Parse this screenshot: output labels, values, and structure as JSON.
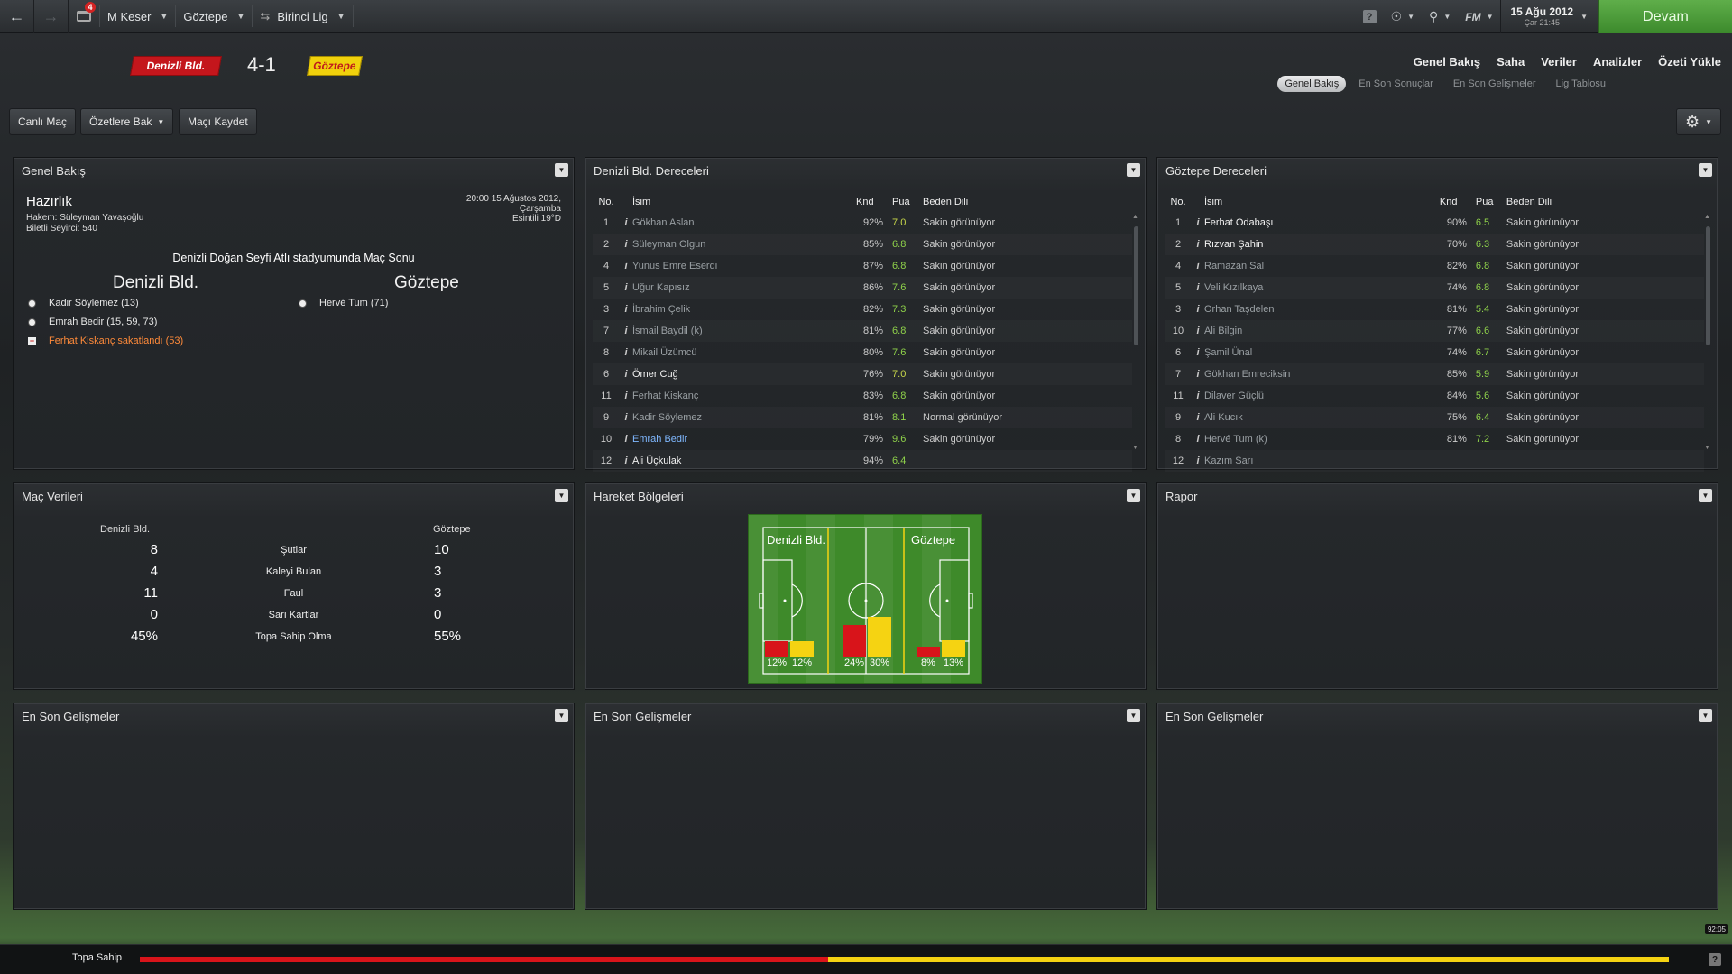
{
  "topbar": {
    "manager": "M Keser",
    "team": "Göztepe",
    "league": "Birinci Lig",
    "inbox_count": "4",
    "fm_label": "FM",
    "date": "15 Ağu 2012",
    "time": "Çar 21:45",
    "continue": "Devam"
  },
  "header": {
    "home": "Denizli Bld.",
    "away": "Göztepe",
    "score": "4-1",
    "main_tabs": [
      "Genel Bakış",
      "Saha",
      "Veriler",
      "Analizler",
      "Özeti Yükle"
    ],
    "sub_tabs": [
      "Genel Bakış",
      "En Son Sonuçlar",
      "En Son Gelişmeler",
      "Lig Tablosu"
    ]
  },
  "toolbar": {
    "live": "Canlı Maç",
    "highlights": "Özetlere Bak",
    "save": "Maçı Kaydet"
  },
  "overview": {
    "title": "Genel Bakış",
    "subtitle": "Hazırlık",
    "referee": "Hakem: Süleyman Yavaşoğlu",
    "attendance": "Biletli Seyirci: 540",
    "datetime": "20:00 15 Ağustos 2012,",
    "weekday": "Çarşamba",
    "weather": "Esintili 19°D",
    "venue": "Denizli Doğan Seyfi Atlı stadyumunda Maç Sonu",
    "home": "Denizli Bld.",
    "away": "Göztepe",
    "home_events": [
      "Kadir Söylemez (13)",
      "Emrah Bedir (15, 59, 73)",
      "Ferhat Kiskanç sakatlandı (53)"
    ],
    "away_events": [
      "Hervé Tum (71)"
    ]
  },
  "home_ratings": {
    "title": "Denizli Bld. Dereceleri",
    "cols": [
      "No.",
      "İsim",
      "Knd",
      "Pua",
      "Beden Dili"
    ],
    "rows": [
      {
        "no": "1",
        "name": "Gökhan Aslan",
        "knd": "92%",
        "pua": "7.0",
        "bd": "Sakin görünüyor",
        "puac": "#c8d84a",
        "st": "dim"
      },
      {
        "no": "2",
        "name": "Süleyman Olgun",
        "knd": "85%",
        "pua": "6.8",
        "bd": "Sakin görünüyor",
        "puac": "#8fd24a",
        "st": "dim"
      },
      {
        "no": "4",
        "name": "Yunus Emre Eserdi",
        "knd": "87%",
        "pua": "6.8",
        "bd": "Sakin görünüyor",
        "puac": "#8fd24a",
        "st": "dim"
      },
      {
        "no": "5",
        "name": "Uğur Kapısız",
        "knd": "86%",
        "pua": "7.6",
        "bd": "Sakin görünüyor",
        "puac": "#8fd24a",
        "st": "dim"
      },
      {
        "no": "3",
        "name": "İbrahim Çelik",
        "knd": "82%",
        "pua": "7.3",
        "bd": "Sakin görünüyor",
        "puac": "#8fd24a",
        "st": "dim"
      },
      {
        "no": "7",
        "name": "İsmail Baydil (k)",
        "knd": "81%",
        "pua": "6.8",
        "bd": "Sakin görünüyor",
        "puac": "#8fd24a",
        "st": "dim"
      },
      {
        "no": "8",
        "name": "Mikail Üzümcü",
        "knd": "80%",
        "pua": "7.6",
        "bd": "Sakin görünüyor",
        "puac": "#8fd24a",
        "st": "dim"
      },
      {
        "no": "6",
        "name": "Ömer Cuğ",
        "knd": "76%",
        "pua": "7.0",
        "bd": "Sakin görünüyor",
        "puac": "#c8d84a",
        "st": "br"
      },
      {
        "no": "11",
        "name": "Ferhat Kiskanç",
        "knd": "83%",
        "pua": "6.8",
        "bd": "Sakin görünüyor",
        "puac": "#8fd24a",
        "st": "dim"
      },
      {
        "no": "9",
        "name": "Kadir Söylemez",
        "knd": "81%",
        "pua": "8.1",
        "bd": "Normal görünüyor",
        "puac": "#8fd24a",
        "st": "dim"
      },
      {
        "no": "10",
        "name": "Emrah Bedir",
        "knd": "79%",
        "pua": "9.6",
        "bd": "Sakin görünüyor",
        "puac": "#8fd24a",
        "st": "bl"
      },
      {
        "no": "12",
        "name": "Ali Üçkulak",
        "knd": "94%",
        "pua": "6.4",
        "bd": "",
        "puac": "#8fd24a",
        "st": "br"
      }
    ]
  },
  "away_ratings": {
    "title": "Göztepe Dereceleri",
    "cols": [
      "No.",
      "İsim",
      "Knd",
      "Pua",
      "Beden Dili"
    ],
    "rows": [
      {
        "no": "1",
        "name": "Ferhat Odabaşı",
        "knd": "90%",
        "pua": "6.5",
        "bd": "Sakin görünüyor",
        "puac": "#8fd24a",
        "st": "br"
      },
      {
        "no": "2",
        "name": "Rızvan Şahin",
        "knd": "70%",
        "pua": "6.3",
        "bd": "Sakin görünüyor",
        "puac": "#8fd24a",
        "st": "br"
      },
      {
        "no": "4",
        "name": "Ramazan Sal",
        "knd": "82%",
        "pua": "6.8",
        "bd": "Sakin görünüyor",
        "puac": "#8fd24a",
        "st": "dim"
      },
      {
        "no": "5",
        "name": "Veli Kızılkaya",
        "knd": "74%",
        "pua": "6.8",
        "bd": "Sakin görünüyor",
        "puac": "#8fd24a",
        "st": "dim"
      },
      {
        "no": "3",
        "name": "Orhan Taşdelen",
        "knd": "81%",
        "pua": "5.4",
        "bd": "Sakin görünüyor",
        "puac": "#8fd24a",
        "st": "dim"
      },
      {
        "no": "10",
        "name": "Ali Bilgin",
        "knd": "77%",
        "pua": "6.6",
        "bd": "Sakin görünüyor",
        "puac": "#8fd24a",
        "st": "dim"
      },
      {
        "no": "6",
        "name": "Şamil Ünal",
        "knd": "74%",
        "pua": "6.7",
        "bd": "Sakin görünüyor",
        "puac": "#8fd24a",
        "st": "dim"
      },
      {
        "no": "7",
        "name": "Gökhan Emreciksin",
        "knd": "85%",
        "pua": "5.9",
        "bd": "Sakin görünüyor",
        "puac": "#8fd24a",
        "st": "dim"
      },
      {
        "no": "11",
        "name": "Dilaver Güçlü",
        "knd": "84%",
        "pua": "5.6",
        "bd": "Sakin görünüyor",
        "puac": "#8fd24a",
        "st": "dim"
      },
      {
        "no": "9",
        "name": "Ali Kucık",
        "knd": "75%",
        "pua": "6.4",
        "bd": "Sakin görünüyor",
        "puac": "#8fd24a",
        "st": "dim"
      },
      {
        "no": "8",
        "name": "Hervé Tum (k)",
        "knd": "81%",
        "pua": "7.2",
        "bd": "Sakin görünüyor",
        "puac": "#8fd24a",
        "st": "dim"
      },
      {
        "no": "12",
        "name": "Kazım Sarı",
        "knd": "",
        "pua": "",
        "bd": "",
        "puac": "#8fd24a",
        "st": "dim"
      }
    ]
  },
  "stats": {
    "title": "Maç Verileri",
    "home": "Denizli Bld.",
    "away": "Göztepe",
    "rows": [
      {
        "label": "Şutlar",
        "home": "8",
        "away": "10"
      },
      {
        "label": "Kaleyi Bulan",
        "home": "4",
        "away": "3"
      },
      {
        "label": "Faul",
        "home": "11",
        "away": "3"
      },
      {
        "label": "Sarı Kartlar",
        "home": "0",
        "away": "0"
      },
      {
        "label": "Topa Sahip Olma",
        "home": "45%",
        "away": "55%"
      }
    ]
  },
  "zones": {
    "title": "Hareket Bölgeleri",
    "home": "Denizli Bld.",
    "away": "Göztepe",
    "bars": [
      {
        "home": 12,
        "away": 12,
        "home_label": "12%",
        "away_label": "12%"
      },
      {
        "home": 24,
        "away": 30,
        "home_label": "24%",
        "away_label": "30%"
      },
      {
        "home": 8,
        "away": 13,
        "home_label": "8%",
        "away_label": "13%"
      }
    ],
    "colors": {
      "home": "#d8141a",
      "away": "#f5d312",
      "pitch": "#3e8a2a"
    }
  },
  "report": {
    "title": "Rapor"
  },
  "news": {
    "title": "En Son Gelişmeler"
  },
  "bottom": {
    "label": "Topa Sahip",
    "home_share": 45,
    "away_share": 55,
    "clock": "92:05"
  }
}
